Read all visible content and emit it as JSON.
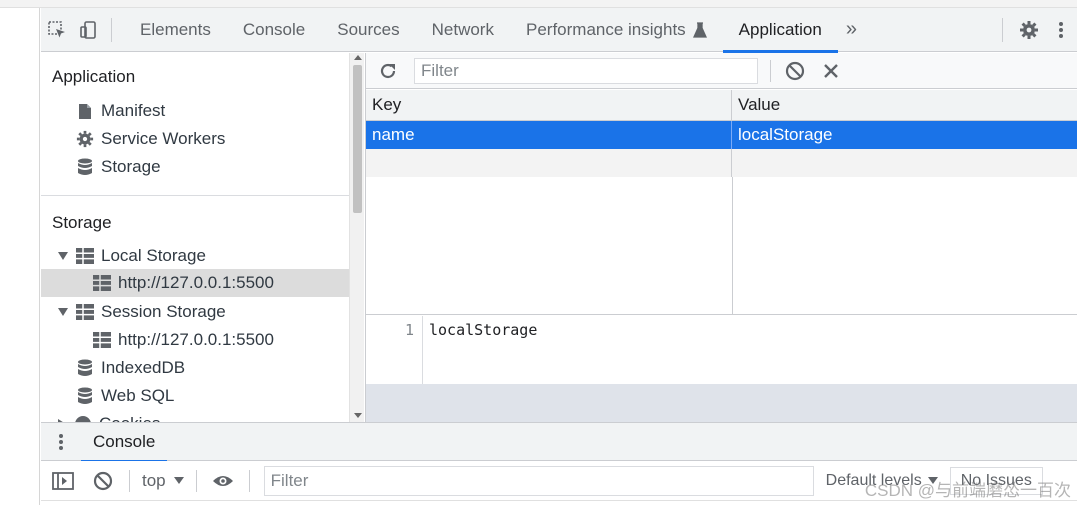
{
  "tabbar": {
    "tabs": [
      {
        "label": "Elements"
      },
      {
        "label": "Console"
      },
      {
        "label": "Sources"
      },
      {
        "label": "Network"
      },
      {
        "label": "Performance insights"
      },
      {
        "label": "Application"
      }
    ],
    "active_tab": "Application",
    "more_glyph": "»"
  },
  "sidebar": {
    "application_section": {
      "title": "Application",
      "items": [
        {
          "label": "Manifest",
          "icon": "file-icon"
        },
        {
          "label": "Service Workers",
          "icon": "gear-icon"
        },
        {
          "label": "Storage",
          "icon": "database-icon"
        }
      ]
    },
    "storage_section": {
      "title": "Storage",
      "local_storage": {
        "label": "Local Storage",
        "expanded": true,
        "child": "http://127.0.0.1:5500"
      },
      "session_storage": {
        "label": "Session Storage",
        "expanded": true,
        "child": "http://127.0.0.1:5500"
      },
      "indexeddb": "IndexedDB",
      "websql": "Web SQL",
      "cookies": "Cookies"
    }
  },
  "main": {
    "filter_placeholder": "Filter",
    "columns": {
      "key": "Key",
      "value": "Value"
    },
    "rows": [
      {
        "key": "name",
        "value": "localStorage",
        "selected": true
      }
    ],
    "preview": {
      "line_number": "1",
      "text": "localStorage"
    }
  },
  "drawer": {
    "tab_label": "Console",
    "context": "top",
    "filter_placeholder": "Filter",
    "levels_label": "Default levels",
    "issues_label": "No Issues"
  },
  "watermark": "CSDN @与前端磨怂一百次",
  "colors": {
    "accent": "#1a73e8",
    "selected_row": "#1a73e8",
    "sidebar_selected": "#dcdcdc"
  }
}
